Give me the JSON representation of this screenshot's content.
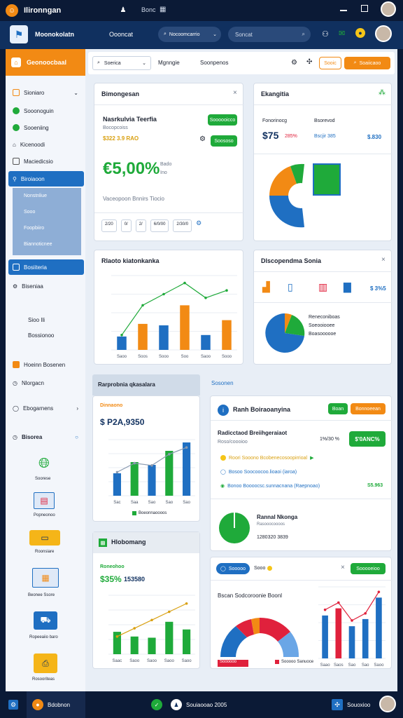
{
  "window": {
    "title": "Ilironngan",
    "tab": "Bonc"
  },
  "appbar": {
    "brand": "Moonokolatn",
    "center_label": "Oooncat",
    "dropdown_label": "Nocoomcarrio",
    "search_placeholder": "Soncat"
  },
  "toolbar": {
    "search_label": "Soerica",
    "link1": "Mgnngie",
    "link2": "Soonpenos",
    "action1": "Sooic",
    "action2": "Soaiicaoo"
  },
  "sidebar": {
    "header": "Geonoocbaal",
    "items": [
      "Sioniaro",
      "Sooonoguin",
      "Sooeniing",
      "Kicenoodi",
      "Maciedicsio"
    ],
    "active_group": "Biroiaoon",
    "sub_items": [
      "Nonstnliue",
      "Sooo",
      "Foopbiiro",
      "Biannoticnee"
    ],
    "active2": "Bosiiteria",
    "items2": [
      "Biseniaa"
    ],
    "mid_items": [
      "Sioo Ili",
      "Bossionoo"
    ],
    "items3": [
      "Hoeinn Bosenen",
      "Nlorgacn",
      "Ebogarnens",
      "Bisorea"
    ],
    "gallery": [
      "Soorese",
      "Popneonoo",
      "Roonsiare",
      "Beonee Ssore",
      "Ropeeaiio baro",
      "Rosooriteas"
    ]
  },
  "card1": {
    "title": "Bimongesan",
    "subtitle": "Nasrkulvia Teerfia",
    "sub2": "Bocopcoiss",
    "sub3": "$322 3.9 RAO",
    "btn1": "Soooooicco",
    "btn2": "Soososo",
    "big": "€5,00%",
    "big_note1": "Bado",
    "big_note2": "Ino",
    "footer": "Vaceopoon Bnnirs Tiocio",
    "pag": [
      "2/20",
      "0/",
      "2/",
      "6/0/00",
      "2/30/0"
    ]
  },
  "card2": {
    "title": "Ekangitia",
    "label1": "Fonorinocg",
    "label2": "Bsorevod",
    "value1": "$75",
    "value1b": "285%",
    "value2": "Bscjir 385",
    "value3": "$.830"
  },
  "card3": {
    "title": "Rlaoto kiatonkanka"
  },
  "card4": {
    "title": "Dlscopendma Sonia",
    "value": "$ 3%5",
    "legend1": "Reneconiboas",
    "legend2": "Soeooiooee",
    "legend3": "Boasoooooe"
  },
  "card5": {
    "tab": "Rarprobnia qkasalara",
    "label": "Dinnaono",
    "value": "$ P2A,9350",
    "legend": "Boeonnaoooos"
  },
  "card6": {
    "tab": "Sosonen",
    "title": "Ranh Boiraoanyina",
    "btn1": "Boan",
    "btn2": "Bonnoeean",
    "subtitle": "Radicctaod Breiihgeraiaot",
    "sub2": "Roso/coooioo",
    "pct": "1%/30 %",
    "badge": "$'0ANC%",
    "rows": [
      "Roori Sooono Bcobenecosoopirrioal",
      "Bosoo Soocoocoo.lioaoi (iaroa)",
      "Bonoo Boooocsc.sunnacnana (Raepnoao)"
    ],
    "row3_val": "S5.963",
    "ring_title": "Rannal Nkonga",
    "ring_sub": "Rasooocoooos",
    "ring_val": "1280320 3839"
  },
  "card7": {
    "tab": "Hlobomang",
    "label": "Roneohoo",
    "value": "$35%",
    "value2": "153580"
  },
  "card8": {
    "chip": "Sooooo",
    "chip2": "Sooo",
    "btn": "Sooooeioo",
    "title": "Bscan Sodcoroonie Boonl",
    "legend1": "Soooooo",
    "legend2": "Sooooo Sanuoce"
  },
  "bottom": {
    "app": "Bdobnon",
    "center": "Souiaooao 2005",
    "right": "Souoxioo"
  },
  "colors": {
    "accent": "#f28a14",
    "primary": "#1f6fc2",
    "success": "#1faa3a",
    "danger": "#e0213c",
    "appbar": "#10305f"
  },
  "chart_data": [
    {
      "type": "bar",
      "title": "Rlaoto kiatonkanka",
      "categories": [
        "Saoo",
        "Soos",
        "Sooo",
        "Soo",
        "Saoo",
        "Sooo"
      ],
      "values": [
        18,
        35,
        33,
        60,
        20,
        40
      ],
      "line": [
        20,
        60,
        75,
        90,
        70,
        80
      ],
      "ylim": [
        0,
        100
      ]
    },
    {
      "type": "bar",
      "title": "Rarprobnia qkasalara",
      "categories": [
        "Sac",
        "Saa",
        "Sao",
        "Sao",
        "Sao"
      ],
      "values": [
        40,
        60,
        55,
        80,
        95
      ],
      "ylim": [
        0,
        100
      ]
    },
    {
      "type": "bar",
      "title": "Hlobomang",
      "categories": [
        "Saac",
        "Saoo",
        "Saoo",
        "Saoo",
        "Saoo"
      ],
      "values": [
        38,
        30,
        28,
        55,
        42
      ],
      "ylim": [
        0,
        100
      ]
    },
    {
      "type": "bar",
      "title": "Bscan Sodcoroonie Boonl",
      "categories": [
        "Saao",
        "Saos",
        "Sao",
        "Sao",
        "Saoo"
      ],
      "values": [
        60,
        70,
        45,
        55,
        85
      ],
      "ylim": [
        0,
        100
      ]
    }
  ]
}
